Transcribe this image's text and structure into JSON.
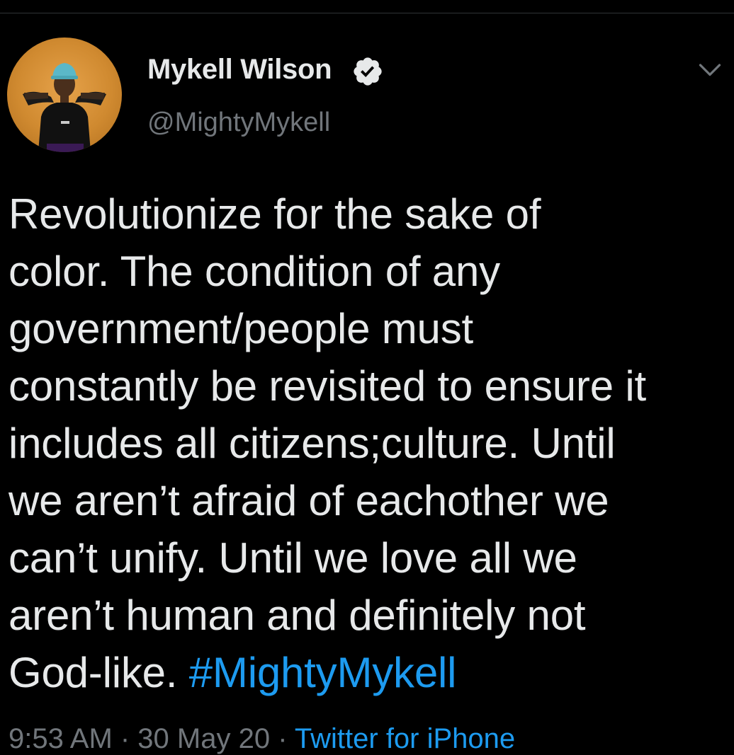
{
  "tweet": {
    "author": {
      "name": "Mykell Wilson",
      "handle": "@MightyMykell",
      "verified": true,
      "avatar_icon": "profile-photo"
    },
    "text_lines": [
      "Revolutionize for the sake of",
      "color. The condition of any",
      "government/people must",
      "constantly be revisited to ensure it",
      "includes all citizens;culture. Until",
      "we aren’t afraid of eachother we",
      "can’t unify. Until we love all we",
      "aren’t human and definitely not"
    ],
    "last_line_text": "God-like. ",
    "hashtag": "#MightyMykell",
    "meta": {
      "time": "9:53 AM · 30 May 20 · ",
      "source": "Twitter for iPhone"
    },
    "menu_icon": "chevron-down-icon"
  },
  "colors": {
    "background": "#000000",
    "text": "#e7e9ea",
    "secondary_text": "#71767b",
    "accent": "#1d9bf0",
    "divider": "#2f3336"
  }
}
